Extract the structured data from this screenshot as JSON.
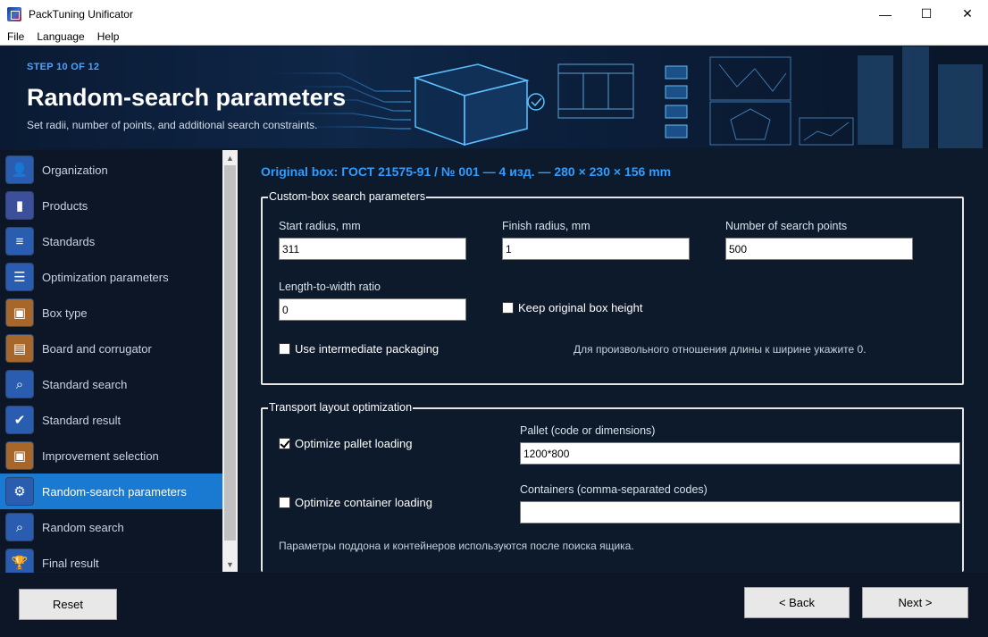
{
  "window": {
    "title": "PackTuning Unificator",
    "controls": {
      "minimize": "—",
      "maximize": "☐",
      "close": "✕"
    }
  },
  "menu": {
    "file": "File",
    "language": "Language",
    "help": "Help"
  },
  "banner": {
    "step": "STEP 10 OF 12",
    "title": "Random-search parameters",
    "subtitle": "Set radii, number of points, and additional search constraints."
  },
  "sidebar": {
    "items": [
      {
        "label": "Organization",
        "icon": "organization-icon",
        "glyph": "👤",
        "color": "#2a5db0"
      },
      {
        "label": "Products",
        "icon": "products-icon",
        "glyph": "▮",
        "color": "#3b4f9a"
      },
      {
        "label": "Standards",
        "icon": "standards-icon",
        "glyph": "≡",
        "color": "#2a5db0"
      },
      {
        "label": "Optimization parameters",
        "icon": "optimization-icon",
        "glyph": "☰",
        "color": "#2a5db0"
      },
      {
        "label": "Box type",
        "icon": "box-type-icon",
        "glyph": "▣",
        "color": "#a8672a"
      },
      {
        "label": "Board and corrugator",
        "icon": "board-icon",
        "glyph": "▤",
        "color": "#a8672a"
      },
      {
        "label": "Standard search",
        "icon": "standard-search-icon",
        "glyph": "⌕",
        "color": "#2a5db0"
      },
      {
        "label": "Standard result",
        "icon": "standard-result-icon",
        "glyph": "✔",
        "color": "#2a5db0"
      },
      {
        "label": "Improvement selection",
        "icon": "improvement-icon",
        "glyph": "▣",
        "color": "#a8672a"
      },
      {
        "label": "Random-search parameters",
        "icon": "random-params-icon",
        "glyph": "⚙",
        "color": "#2a5db0"
      },
      {
        "label": "Random search",
        "icon": "random-search-icon",
        "glyph": "⌕",
        "color": "#2a5db0"
      },
      {
        "label": "Final result",
        "icon": "final-result-icon",
        "glyph": "🏆",
        "color": "#2a5db0"
      }
    ],
    "active_index": 9
  },
  "main": {
    "original_box": "Original box: ГОСТ 21575-91 / № 001 — 4 изд. — 280 × 230 × 156 mm",
    "custom": {
      "legend": "Custom-box search parameters",
      "start_radius_label": "Start radius, mm",
      "start_radius_value": "311",
      "finish_radius_label": "Finish radius, mm",
      "finish_radius_value": "1",
      "points_label": "Number of search points",
      "points_value": "500",
      "ratio_label": "Length-to-width ratio",
      "ratio_value": "0",
      "keep_height_label": "Keep original box height",
      "keep_height_checked": false,
      "intermediate_label": "Use intermediate packaging",
      "intermediate_checked": false,
      "ratio_note": "Для произвольного отношения длины к ширине укажите 0."
    },
    "transport": {
      "legend": "Transport layout optimization",
      "pallet_label": "Optimize pallet loading",
      "pallet_checked": true,
      "pallet_field_label": "Pallet (code or dimensions)",
      "pallet_value": "1200*800",
      "container_label": "Optimize container loading",
      "container_checked": false,
      "containers_field_label": "Containers (comma-separated codes)",
      "containers_value": "",
      "note": "Параметры поддона и контейнеров используются после поиска ящика."
    }
  },
  "footer": {
    "reset": "Reset",
    "back": "< Back",
    "next": "Next >"
  }
}
